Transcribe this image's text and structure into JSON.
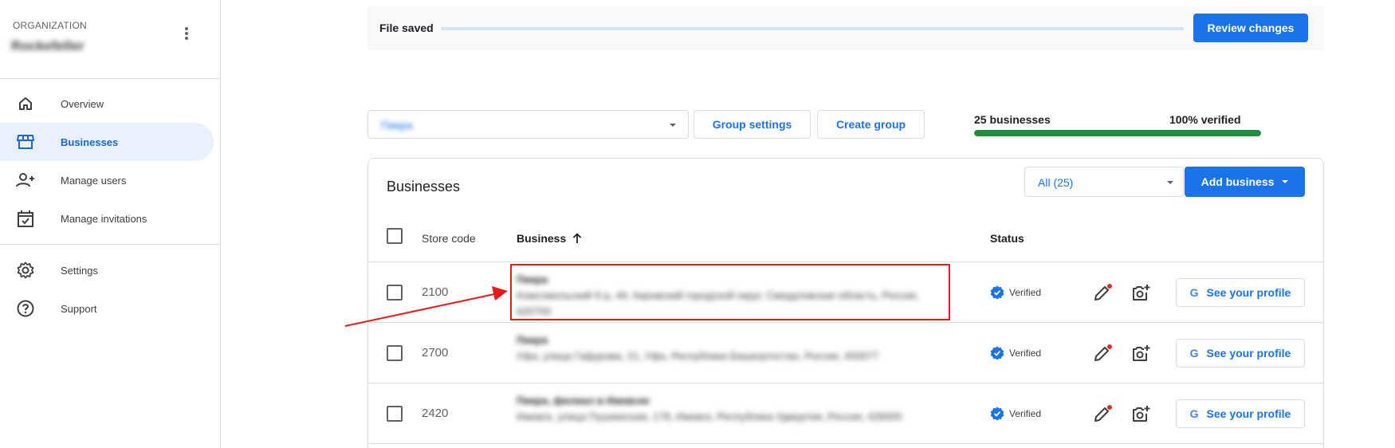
{
  "sidebar": {
    "org_label": "ORGANIZATION",
    "org_name": "Rockefeller",
    "menu_icon": "more-vert-icon",
    "items": [
      {
        "label": "Overview",
        "icon": "home-icon"
      },
      {
        "label": "Businesses",
        "icon": "storefront-icon",
        "active": true
      },
      {
        "label": "Manage users",
        "icon": "person-add-icon"
      },
      {
        "label": "Manage invitations",
        "icon": "calendar-check-icon"
      },
      {
        "label": "Settings",
        "icon": "gear-icon"
      },
      {
        "label": "Support",
        "icon": "help-icon"
      }
    ]
  },
  "savebar": {
    "status": "File saved",
    "review_button": "Review changes"
  },
  "group_bar": {
    "group_select_value": "Пикра",
    "group_settings_button": "Group settings",
    "create_group_button": "Create group",
    "business_count": "25 businesses",
    "verified_label": "100% verified",
    "verified_fraction": 1.0
  },
  "card": {
    "title": "Businesses",
    "filter_value": "All (25)",
    "add_business_button": "Add business",
    "columns": {
      "store_code": "Store code",
      "business": "Business",
      "status": "Status"
    },
    "rows": [
      {
        "store_code": "2100",
        "name": "Пикра",
        "address": "Комсомольский б-р, 49, Кировский городской округ, Свердловская область, Россия, 620700",
        "status": "Verified",
        "profile_button": "See your profile"
      },
      {
        "store_code": "2700",
        "name": "Пикра",
        "address": "Уфа, улица Гафурова, 21, Уфа, Республика Башкортостан, Россия, 450077",
        "status": "Verified",
        "profile_button": "See your profile"
      },
      {
        "store_code": "2420",
        "name": "Пикра, филиал в Ижевске",
        "address": "Ижевск, улица Пушкинская, 178, Ижевск, Республика Удмуртия, Россия, 426000",
        "status": "Verified",
        "profile_button": "See your profile"
      }
    ]
  },
  "colors": {
    "primary": "#1a73e8",
    "verified_green": "#1e8e3e",
    "annotation_red": "#ea1a1a",
    "active_nav_bg": "#e8f0fe"
  }
}
